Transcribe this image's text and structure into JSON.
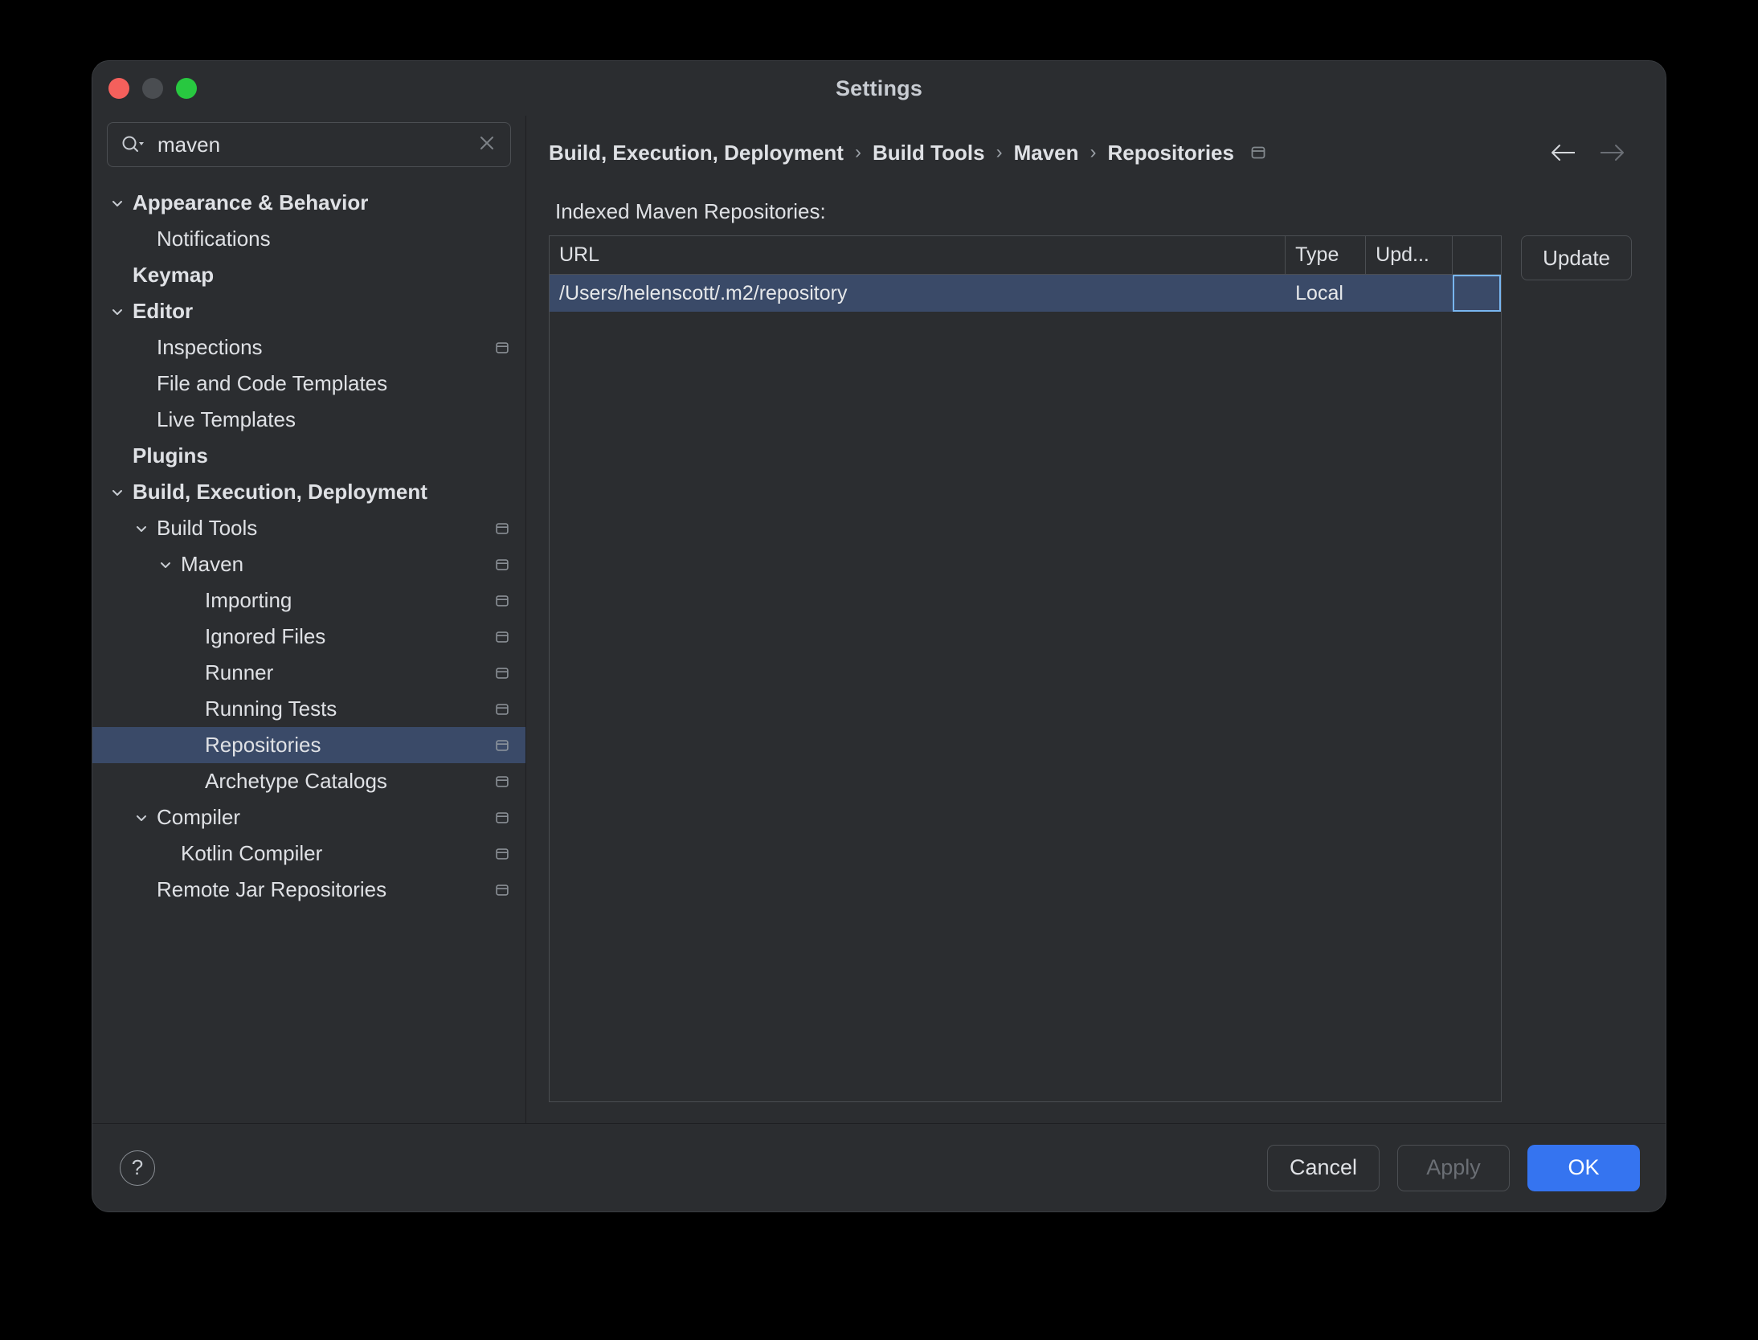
{
  "window": {
    "title": "Settings",
    "traffic_lights": [
      "close",
      "minimize",
      "zoom"
    ]
  },
  "search": {
    "value": "maven",
    "placeholder": "Search settings",
    "icon": "search-icon",
    "clear_icon": "close-icon"
  },
  "sidebar": {
    "items": [
      {
        "label": "Appearance & Behavior",
        "indent": 0,
        "bold": true,
        "chevron": "down",
        "scope_icon": false,
        "selected": false
      },
      {
        "label": "Notifications",
        "indent": 1,
        "bold": false,
        "chevron": "",
        "scope_icon": false,
        "selected": false
      },
      {
        "label": "Keymap",
        "indent": 0,
        "bold": true,
        "chevron": "",
        "scope_icon": false,
        "selected": false
      },
      {
        "label": "Editor",
        "indent": 0,
        "bold": true,
        "chevron": "down",
        "scope_icon": false,
        "selected": false
      },
      {
        "label": "Inspections",
        "indent": 1,
        "bold": false,
        "chevron": "",
        "scope_icon": true,
        "selected": false
      },
      {
        "label": "File and Code Templates",
        "indent": 1,
        "bold": false,
        "chevron": "",
        "scope_icon": false,
        "selected": false
      },
      {
        "label": "Live Templates",
        "indent": 1,
        "bold": false,
        "chevron": "",
        "scope_icon": false,
        "selected": false
      },
      {
        "label": "Plugins",
        "indent": 0,
        "bold": true,
        "chevron": "",
        "scope_icon": false,
        "selected": false
      },
      {
        "label": "Build, Execution, Deployment",
        "indent": 0,
        "bold": true,
        "chevron": "down",
        "scope_icon": false,
        "selected": false
      },
      {
        "label": "Build Tools",
        "indent": 1,
        "bold": false,
        "chevron": "down",
        "scope_icon": true,
        "selected": false
      },
      {
        "label": "Maven",
        "indent": 2,
        "bold": false,
        "chevron": "down",
        "scope_icon": true,
        "selected": false
      },
      {
        "label": "Importing",
        "indent": 3,
        "bold": false,
        "chevron": "",
        "scope_icon": true,
        "selected": false
      },
      {
        "label": "Ignored Files",
        "indent": 3,
        "bold": false,
        "chevron": "",
        "scope_icon": true,
        "selected": false
      },
      {
        "label": "Runner",
        "indent": 3,
        "bold": false,
        "chevron": "",
        "scope_icon": true,
        "selected": false
      },
      {
        "label": "Running Tests",
        "indent": 3,
        "bold": false,
        "chevron": "",
        "scope_icon": true,
        "selected": false
      },
      {
        "label": "Repositories",
        "indent": 3,
        "bold": false,
        "chevron": "",
        "scope_icon": true,
        "selected": true
      },
      {
        "label": "Archetype Catalogs",
        "indent": 3,
        "bold": false,
        "chevron": "",
        "scope_icon": true,
        "selected": false
      },
      {
        "label": "Compiler",
        "indent": 1,
        "bold": false,
        "chevron": "down",
        "scope_icon": true,
        "selected": false
      },
      {
        "label": "Kotlin Compiler",
        "indent": 2,
        "bold": false,
        "chevron": "",
        "scope_icon": true,
        "selected": false
      },
      {
        "label": "Remote Jar Repositories",
        "indent": 1,
        "bold": false,
        "chevron": "",
        "scope_icon": true,
        "selected": false
      }
    ]
  },
  "breadcrumb": {
    "items": [
      "Build, Execution, Deployment",
      "Build Tools",
      "Maven",
      "Repositories"
    ],
    "separator": "›",
    "trailing_icon": "project-scope-icon"
  },
  "nav": {
    "back_icon": "arrow-left-icon",
    "forward_icon": "arrow-right-icon"
  },
  "main": {
    "section_label": "Indexed Maven Repositories:",
    "update_button": "Update",
    "table": {
      "columns": [
        "URL",
        "Type",
        "Upd...",
        ""
      ],
      "rows": [
        {
          "url": "/Users/helenscott/.m2/repository",
          "type": "Local",
          "updated": "",
          "action": "",
          "selected": true
        }
      ]
    }
  },
  "footer": {
    "help_label": "?",
    "cancel_label": "Cancel",
    "apply_label": "Apply",
    "ok_label": "OK"
  },
  "colors": {
    "window_bg": "#2b2d30",
    "selection_blue": "#3a4a68",
    "primary_blue": "#3574f0",
    "focus_ring": "#78b6f0",
    "text": "#dfe1e5",
    "muted_text": "#6b6f75"
  }
}
